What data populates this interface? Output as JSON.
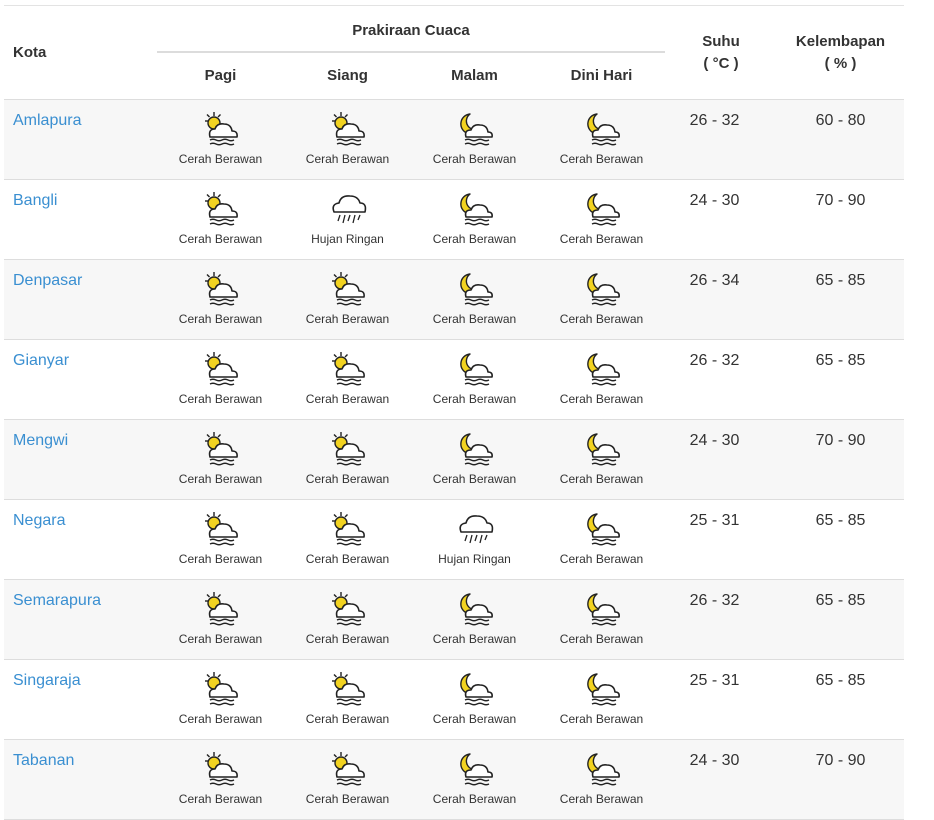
{
  "header": {
    "kota": "Kota",
    "group": "Prakiraan Cuaca",
    "periods": [
      "Pagi",
      "Siang",
      "Malam",
      "Dini Hari"
    ],
    "suhu_line1": "Suhu",
    "suhu_line2": "( °C )",
    "kelembapan_line1": "Kelembapan",
    "kelembapan_line2": "( % )"
  },
  "rows": [
    {
      "city": "Amlapura",
      "forecast": [
        {
          "icon": "sun-cloud-icon",
          "label": "Cerah Berawan"
        },
        {
          "icon": "sun-cloud-icon",
          "label": "Cerah Berawan"
        },
        {
          "icon": "moon-cloud-icon",
          "label": "Cerah Berawan"
        },
        {
          "icon": "moon-cloud-icon",
          "label": "Cerah Berawan"
        }
      ],
      "suhu": "26 - 32",
      "kelembapan": "60 - 80"
    },
    {
      "city": "Bangli",
      "forecast": [
        {
          "icon": "sun-cloud-icon",
          "label": "Cerah Berawan"
        },
        {
          "icon": "rain-cloud-icon",
          "label": "Hujan Ringan"
        },
        {
          "icon": "moon-cloud-icon",
          "label": "Cerah Berawan"
        },
        {
          "icon": "moon-cloud-icon",
          "label": "Cerah Berawan"
        }
      ],
      "suhu": "24 - 30",
      "kelembapan": "70 - 90"
    },
    {
      "city": "Denpasar",
      "forecast": [
        {
          "icon": "sun-cloud-icon",
          "label": "Cerah Berawan"
        },
        {
          "icon": "sun-cloud-icon",
          "label": "Cerah Berawan"
        },
        {
          "icon": "moon-cloud-icon",
          "label": "Cerah Berawan"
        },
        {
          "icon": "moon-cloud-icon",
          "label": "Cerah Berawan"
        }
      ],
      "suhu": "26 - 34",
      "kelembapan": "65 - 85"
    },
    {
      "city": "Gianyar",
      "forecast": [
        {
          "icon": "sun-cloud-icon",
          "label": "Cerah Berawan"
        },
        {
          "icon": "sun-cloud-icon",
          "label": "Cerah Berawan"
        },
        {
          "icon": "moon-cloud-icon",
          "label": "Cerah Berawan"
        },
        {
          "icon": "moon-cloud-icon",
          "label": "Cerah Berawan"
        }
      ],
      "suhu": "26 - 32",
      "kelembapan": "65 - 85"
    },
    {
      "city": "Mengwi",
      "forecast": [
        {
          "icon": "sun-cloud-icon",
          "label": "Cerah Berawan"
        },
        {
          "icon": "sun-cloud-icon",
          "label": "Cerah Berawan"
        },
        {
          "icon": "moon-cloud-icon",
          "label": "Cerah Berawan"
        },
        {
          "icon": "moon-cloud-icon",
          "label": "Cerah Berawan"
        }
      ],
      "suhu": "24 - 30",
      "kelembapan": "70 - 90"
    },
    {
      "city": "Negara",
      "forecast": [
        {
          "icon": "sun-cloud-icon",
          "label": "Cerah Berawan"
        },
        {
          "icon": "sun-cloud-icon",
          "label": "Cerah Berawan"
        },
        {
          "icon": "rain-cloud-icon",
          "label": "Hujan Ringan"
        },
        {
          "icon": "moon-cloud-icon",
          "label": "Cerah Berawan"
        }
      ],
      "suhu": "25 - 31",
      "kelembapan": "65 - 85"
    },
    {
      "city": "Semarapura",
      "forecast": [
        {
          "icon": "sun-cloud-icon",
          "label": "Cerah Berawan"
        },
        {
          "icon": "sun-cloud-icon",
          "label": "Cerah Berawan"
        },
        {
          "icon": "moon-cloud-icon",
          "label": "Cerah Berawan"
        },
        {
          "icon": "moon-cloud-icon",
          "label": "Cerah Berawan"
        }
      ],
      "suhu": "26 - 32",
      "kelembapan": "65 - 85"
    },
    {
      "city": "Singaraja",
      "forecast": [
        {
          "icon": "sun-cloud-icon",
          "label": "Cerah Berawan"
        },
        {
          "icon": "sun-cloud-icon",
          "label": "Cerah Berawan"
        },
        {
          "icon": "moon-cloud-icon",
          "label": "Cerah Berawan"
        },
        {
          "icon": "moon-cloud-icon",
          "label": "Cerah Berawan"
        }
      ],
      "suhu": "25 - 31",
      "kelembapan": "65 - 85"
    },
    {
      "city": "Tabanan",
      "forecast": [
        {
          "icon": "sun-cloud-icon",
          "label": "Cerah Berawan"
        },
        {
          "icon": "sun-cloud-icon",
          "label": "Cerah Berawan"
        },
        {
          "icon": "moon-cloud-icon",
          "label": "Cerah Berawan"
        },
        {
          "icon": "moon-cloud-icon",
          "label": "Cerah Berawan"
        }
      ],
      "suhu": "24 - 30",
      "kelembapan": "70 - 90"
    }
  ],
  "colors": {
    "link": "#3a8fd1",
    "icon_yellow": "#f2d321",
    "row_alt": "#f7f7f7",
    "border": "#dddddd"
  }
}
